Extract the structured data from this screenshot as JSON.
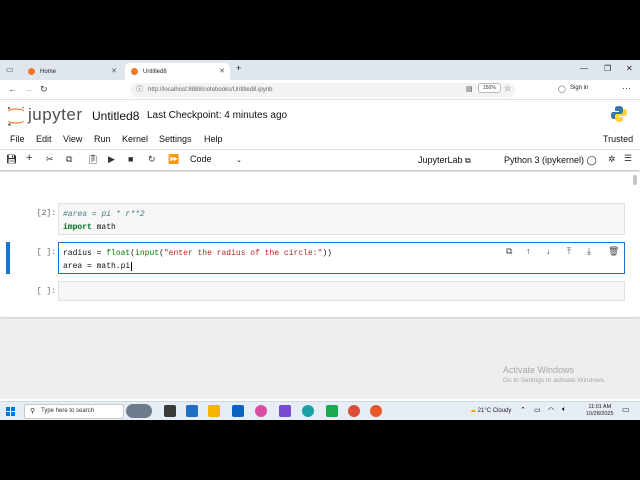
{
  "browser": {
    "tabs": [
      {
        "label": "Home"
      },
      {
        "label": "Untitled8"
      }
    ],
    "url": "http://localhost:8888/notebooks/Untitled8.ipynb",
    "zoom": "150%",
    "signin": "Sign in"
  },
  "jupyter": {
    "logo_text": "jupyter",
    "notebook_name": "Untitled8",
    "checkpoint": "Last Checkpoint: 4 minutes ago"
  },
  "menu": {
    "items": [
      "File",
      "Edit",
      "View",
      "Run",
      "Kernel",
      "Settings",
      "Help"
    ],
    "trusted": "Trusted"
  },
  "toolbar": {
    "cell_type": "Code",
    "jupyterlab": "JupyterLab",
    "kernel": "Python 3 (ipykernel)"
  },
  "cells": [
    {
      "prompt": "[2]:",
      "line1_comment": "#area = pi * r**2",
      "line2_kw": "import",
      "line2_rest": " math"
    },
    {
      "prompt": "[ ]:",
      "line1_a": "radius = ",
      "line1_fn1": "float",
      "line1_b": "(",
      "line1_fn2": "input",
      "line1_c": "(",
      "line1_str": "\"enter the radius of the circle:\"",
      "line1_d": "))",
      "line2": "area = math.pi"
    },
    {
      "prompt": "[ ]:"
    }
  ],
  "watermark": {
    "title": "Activate Windows",
    "subtitle": "Go to Settings to activate Windows."
  },
  "taskbar": {
    "search": "Type here to search",
    "weather": "21°C  Cloudy",
    "time": "11:01 AM",
    "date": "10/28/2025"
  },
  "colors": {
    "accent": "#1976d2",
    "jupyter_orange": "#f37726"
  }
}
